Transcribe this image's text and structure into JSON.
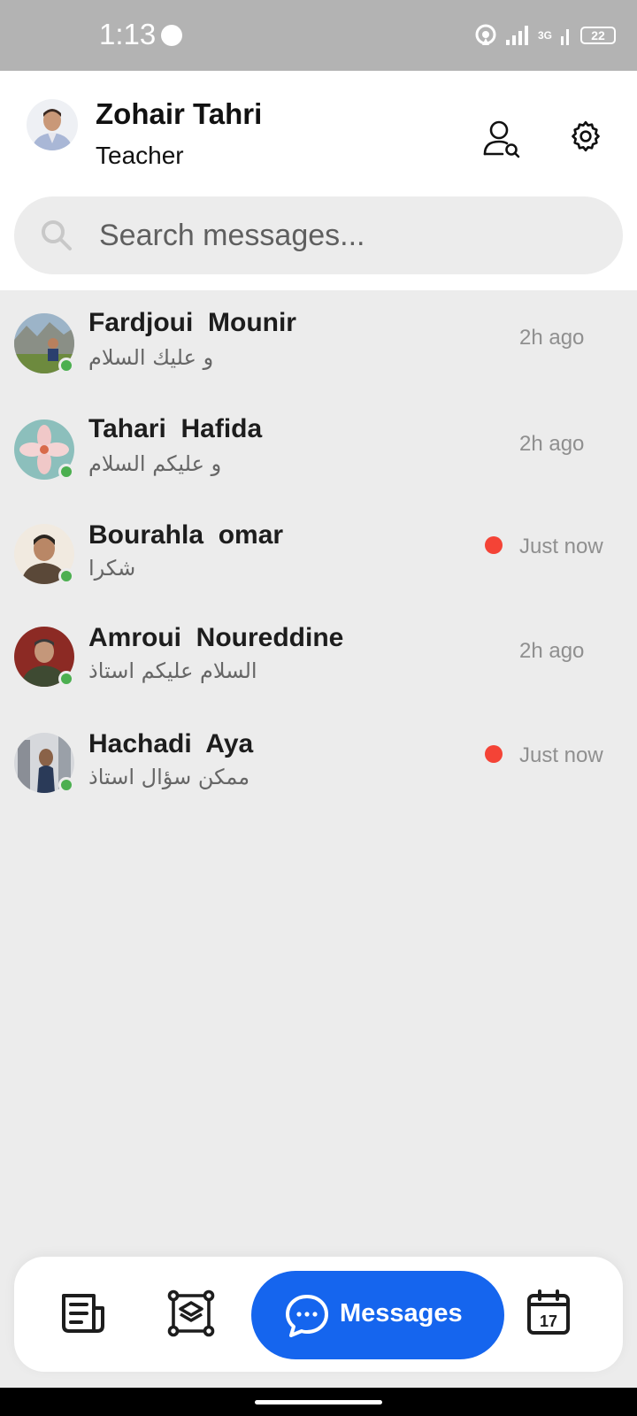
{
  "status_bar": {
    "time": "1:13",
    "network": "3G",
    "battery": "22"
  },
  "header": {
    "name": "Zohair Tahri",
    "role": "Teacher"
  },
  "search": {
    "placeholder": "Search messages..."
  },
  "chats": [
    {
      "name": "Fardjoui  Mounir",
      "message": "و عليك السلام",
      "time": "2h ago",
      "unread": false,
      "online": true
    },
    {
      "name": "Tahari  Hafida",
      "message": "و عليكم السلام",
      "time": "2h ago",
      "unread": false,
      "online": true
    },
    {
      "name": "Bourahla  omar",
      "message": "شكرا",
      "time": "Just now",
      "unread": true,
      "online": true
    },
    {
      "name": "Amroui  Noureddine",
      "message": "السلام عليكم استاذ",
      "time": "2h ago",
      "unread": false,
      "online": true
    },
    {
      "name": "Hachadi  Aya",
      "message": "ممكن سؤال استاذ",
      "time": "Just now",
      "unread": true,
      "online": true
    }
  ],
  "bottom_nav": {
    "active_label": "Messages",
    "calendar_day": "17"
  },
  "colors": {
    "accent": "#1565ee",
    "online": "#4caf50",
    "unread": "#f44336"
  }
}
